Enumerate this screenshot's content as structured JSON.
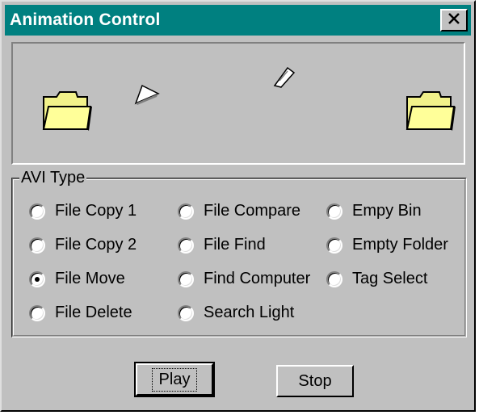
{
  "window": {
    "title": "Animation Control",
    "close_symbol": "×"
  },
  "animation": {
    "left_icon": "folder-icon",
    "right_icon": "folder-icon",
    "paper_icons": [
      "paper-sheet-icon",
      "paper-sheet-icon"
    ]
  },
  "avi_type": {
    "legend": "AVI Type",
    "options": [
      {
        "label": "File Copy 1",
        "checked": false
      },
      {
        "label": "File Copy 2",
        "checked": false
      },
      {
        "label": "File Move",
        "checked": true
      },
      {
        "label": "File Delete",
        "checked": false
      },
      {
        "label": "File Compare",
        "checked": false
      },
      {
        "label": "File Find",
        "checked": false
      },
      {
        "label": "Find Computer",
        "checked": false
      },
      {
        "label": "Search Light",
        "checked": false
      },
      {
        "label": "Empy Bin",
        "checked": false
      },
      {
        "label": "Empty Folder",
        "checked": false
      },
      {
        "label": "Tag Select",
        "checked": false
      }
    ]
  },
  "buttons": {
    "play": "Play",
    "stop": "Stop"
  },
  "colors": {
    "titlebar": "#008080",
    "face": "#c0c0c0",
    "folder": "#f2f28a"
  }
}
